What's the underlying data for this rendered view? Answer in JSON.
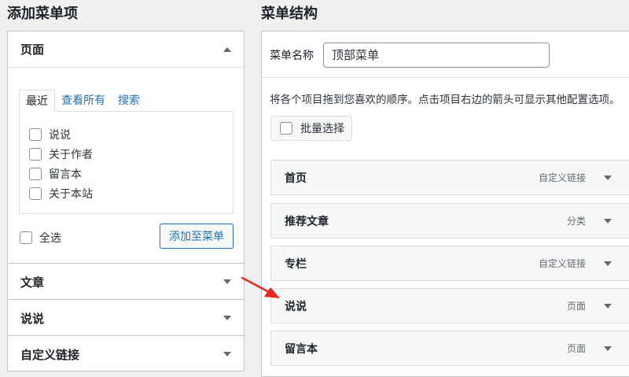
{
  "left": {
    "title": "添加菜单项",
    "pages": {
      "heading": "页面",
      "tabs": [
        "最近",
        "查看所有",
        "搜索"
      ],
      "items": [
        "说说",
        "关于作者",
        "留言本",
        "关于本站"
      ],
      "select_all": "全选",
      "add_button": "添加至菜单"
    },
    "sections": [
      "文章",
      "说说",
      "自定义链接"
    ]
  },
  "right": {
    "title": "菜单结构",
    "menu_name_label": "菜单名称",
    "menu_name_value": "顶部菜单",
    "instructions": "将各个项目拖到您喜欢的顺序。点击项目右边的箭头可显示其他配置选项。",
    "bulk_select": "批量选择",
    "items": [
      {
        "title": "首页",
        "type": "自定义链接"
      },
      {
        "title": "推荐文章",
        "type": "分类"
      },
      {
        "title": "专栏",
        "type": "自定义链接"
      },
      {
        "title": "说说",
        "type": "页面"
      },
      {
        "title": "留言本",
        "type": "页面"
      }
    ]
  },
  "colors": {
    "link": "#2271b1",
    "annotation_arrow": "#e8281e"
  }
}
